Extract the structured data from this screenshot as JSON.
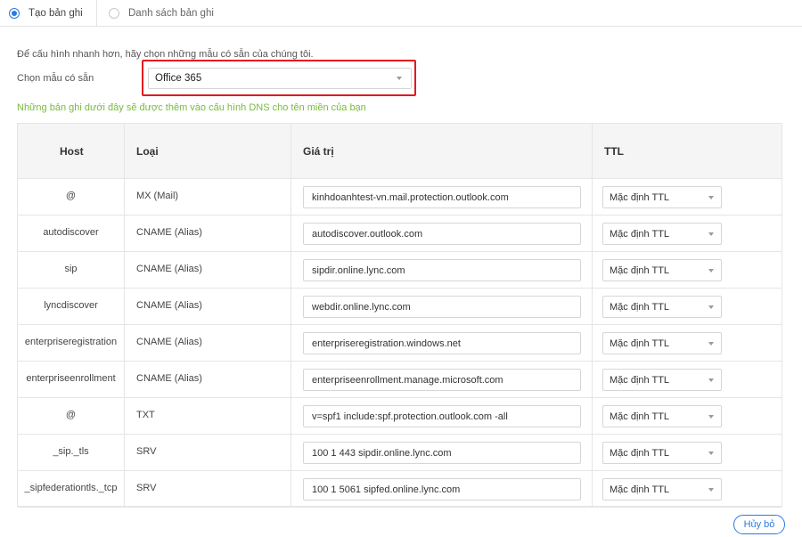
{
  "tabs": [
    {
      "label": "Tạo bản ghi"
    },
    {
      "label": "Danh sách bản ghi"
    }
  ],
  "form": {
    "hint": "Để cấu hình nhanh hơn, hãy chọn những mẫu có sẵn của chúng tôi.",
    "choose_label": "Chọn mẫu có sẵn",
    "template_value": "Office 365",
    "note": "Những bản ghi dưới đây sẽ được thêm vào cấu hình DNS cho tên miền của bạn"
  },
  "table": {
    "headers": {
      "host": "Host",
      "type": "Loại",
      "value": "Giá trị",
      "ttl": "TTL"
    },
    "rows": [
      {
        "host": "@",
        "type": "MX (Mail)",
        "value": "kinhdoanhtest-vn.mail.protection.outlook.com",
        "ttl": "Mặc định TTL"
      },
      {
        "host": "autodiscover",
        "type": "CNAME (Alias)",
        "value": "autodiscover.outlook.com",
        "ttl": "Mặc định TTL"
      },
      {
        "host": "sip",
        "type": "CNAME (Alias)",
        "value": "sipdir.online.lync.com",
        "ttl": "Mặc định TTL"
      },
      {
        "host": "lyncdiscover",
        "type": "CNAME (Alias)",
        "value": "webdir.online.lync.com",
        "ttl": "Mặc định TTL"
      },
      {
        "host": "enterpriseregistration",
        "type": "CNAME (Alias)",
        "value": "enterpriseregistration.windows.net",
        "ttl": "Mặc định TTL"
      },
      {
        "host": "enterpriseenrollment",
        "type": "CNAME (Alias)",
        "value": "enterpriseenrollment.manage.microsoft.com",
        "ttl": "Mặc định TTL"
      },
      {
        "host": "@",
        "type": "TXT",
        "value": "v=spf1 include:spf.protection.outlook.com -all",
        "ttl": "Mặc định TTL"
      },
      {
        "host": "_sip._tls",
        "type": "SRV",
        "value": "100 1 443 sipdir.online.lync.com",
        "ttl": "Mặc định TTL"
      },
      {
        "host": "_sipfederationtls._tcp",
        "type": "SRV",
        "value": "100 1 5061 sipfed.online.lync.com",
        "ttl": "Mặc định TTL"
      }
    ]
  },
  "actions": {
    "cancel_label": "Hủy bỏ"
  },
  "colors": {
    "accent": "#2a7ae2",
    "highlight": "#e3181e",
    "note_green": "#79b93f"
  }
}
